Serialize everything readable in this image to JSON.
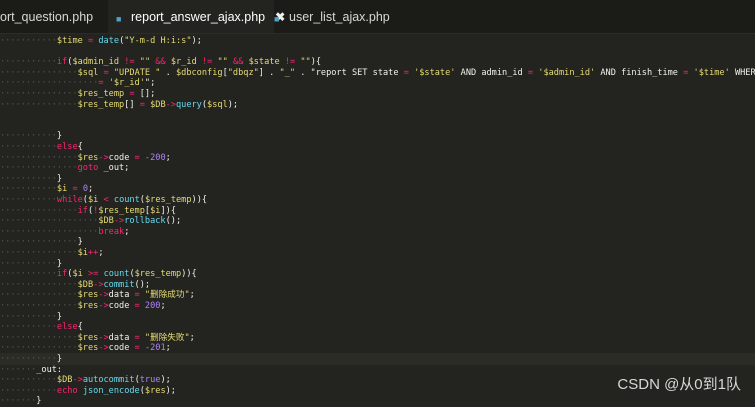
{
  "tabs": [
    {
      "label": "ort_question.php"
    },
    {
      "label": "report_answer_ajax.php",
      "close": "✖"
    },
    {
      "label": "user_list_ajax.php"
    }
  ],
  "code": [
    "$time = date(\"Y-m-d H:i:s\");",
    "",
    "if($admin_id != \"\" && $r_id != \"\" && $state != \"\"){",
    "    $sql = \"UPDATE \" . $dbconfig[\"dbqz\"] . \"_\" . \"report SET state = '$state' AND admin_id = '$admin_id' AND finish_time = '$time' WHERE r_id",
    "= '$r_id'\";",
    "    $res_temp = [];",
    "    $res_temp[] = $DB->query($sql);",
    "",
    "",
    "}",
    "else{",
    "    $res->code = -200;",
    "    goto _out;",
    "}",
    "$i = 0;",
    "while($i < count($res_temp)){",
    "    if(!$res_temp[$i]){",
    "        $DB->rollback();",
    "        break;",
    "    }",
    "    $i++;",
    "}",
    "if($i >= count($res_temp)){",
    "    $DB->commit();",
    "    $res->data = \"删除成功\";",
    "    $res->code = 200;",
    "}",
    "else{",
    "    $res->data = \"删除失败\";",
    "    $res->code = -201;",
    "}",
    "_out:",
    "$DB->autocommit(true);",
    "echo json_encode($res);",
    "}"
  ],
  "watermark": "CSDN @从0到1队",
  "colors": {
    "background": "#23241f",
    "tabbar": "#1b1c18",
    "keyword": "#f92672",
    "string": "#e6db74",
    "function": "#66d9ef",
    "number": "#ae81ff",
    "text": "#f2f2ec"
  },
  "icons": {
    "tab_file_icon": "php-file-icon",
    "tab_close": "close-icon"
  }
}
